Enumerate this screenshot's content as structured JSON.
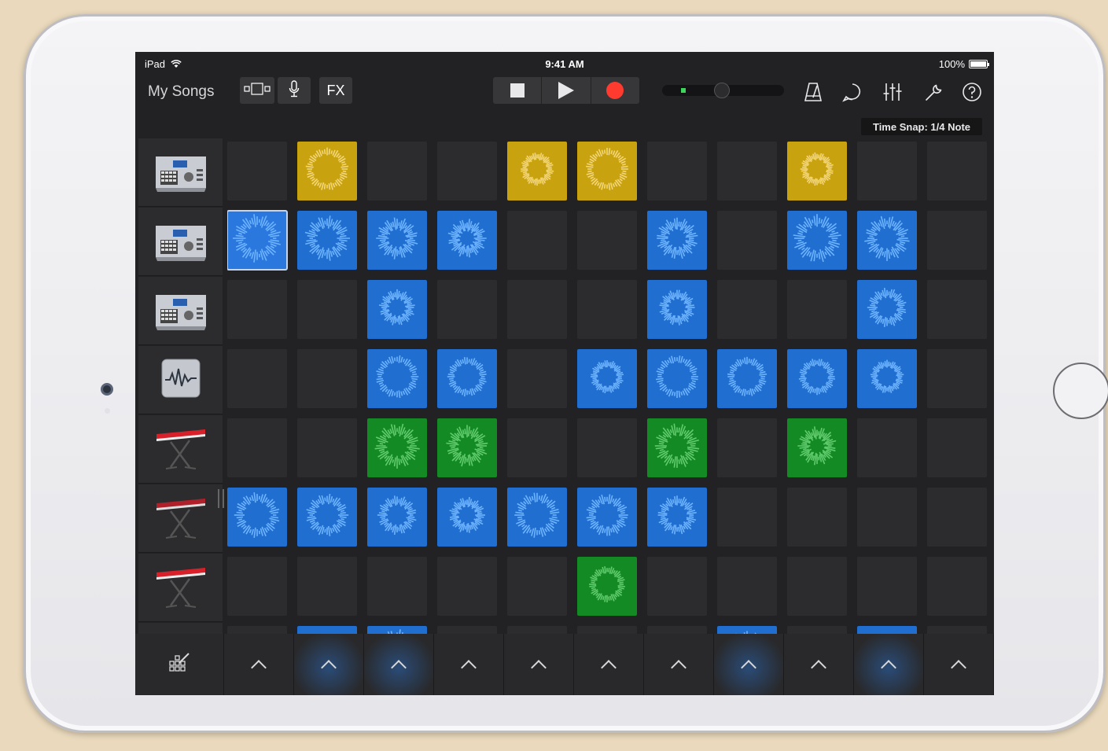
{
  "device": {
    "name": "iPad"
  },
  "statusbar": {
    "carrier": "iPad",
    "time": "9:41 AM",
    "battery": "100%"
  },
  "toolbar": {
    "my_songs": "My Songs",
    "fx_label": "FX",
    "icons": [
      "view-toggle-icon",
      "microphone-icon",
      "stop-icon",
      "play-icon",
      "record-icon",
      "metronome-icon",
      "loop-browser-icon",
      "mixer-icon",
      "settings-wrench-icon",
      "help-icon"
    ]
  },
  "time_snap": "Time Snap: 1/4 Note",
  "tracks": [
    {
      "instrument": "drum-machine"
    },
    {
      "instrument": "drum-machine"
    },
    {
      "instrument": "drum-machine"
    },
    {
      "instrument": "audio-recorder"
    },
    {
      "instrument": "keyboard"
    },
    {
      "instrument": "keyboard"
    },
    {
      "instrument": "keyboard"
    }
  ],
  "grid": {
    "rows": [
      [
        "",
        "yellow",
        "",
        "",
        "yellow",
        "yellow",
        "",
        "",
        "yellow",
        "",
        ""
      ],
      [
        "blue",
        "blue",
        "blue",
        "blue",
        "",
        "",
        "blue",
        "",
        "blue",
        "blue",
        ""
      ],
      [
        "",
        "",
        "blue",
        "",
        "",
        "",
        "blue",
        "",
        "",
        "blue",
        ""
      ],
      [
        "",
        "",
        "blue",
        "blue",
        "",
        "blue",
        "blue",
        "blue",
        "blue",
        "blue",
        ""
      ],
      [
        "",
        "",
        "green",
        "green",
        "",
        "",
        "green",
        "",
        "green",
        "",
        ""
      ],
      [
        "blue",
        "blue",
        "blue",
        "blue",
        "blue",
        "blue",
        "blue",
        "",
        "",
        "",
        ""
      ],
      [
        "",
        "",
        "",
        "",
        "",
        "green",
        "",
        "",
        "",
        "",
        ""
      ],
      [
        "",
        "blue",
        "blue",
        "",
        "",
        "",
        "",
        "blue",
        "",
        "blue",
        ""
      ]
    ],
    "selected": {
      "row": 1,
      "col": 0
    }
  },
  "colors": {
    "yellow": "#c9a20f",
    "blue": "#1f6ed0",
    "green": "#138a24",
    "record": "#ff3b2f",
    "background": "#222224"
  },
  "column_triggers": {
    "active": [
      false,
      true,
      true,
      false,
      false,
      false,
      false,
      true,
      false,
      true,
      false
    ]
  }
}
